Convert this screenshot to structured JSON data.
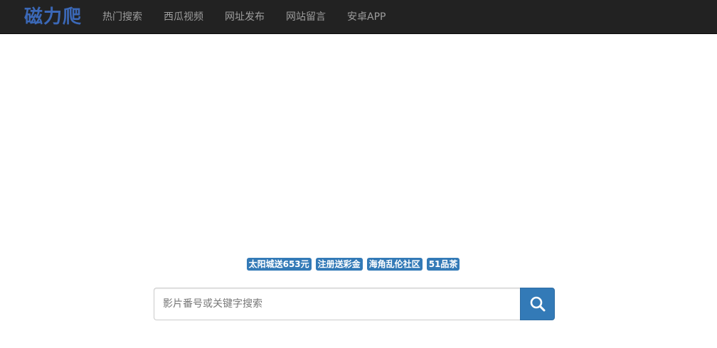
{
  "brand": "磁力爬",
  "nav": {
    "items": [
      {
        "label": "热门搜索"
      },
      {
        "label": "西瓜视频"
      },
      {
        "label": "网址发布"
      },
      {
        "label": "网站留言"
      },
      {
        "label": "安卓APP"
      }
    ]
  },
  "tags": [
    {
      "label": "太阳城送653元"
    },
    {
      "label": "注册送彩金"
    },
    {
      "label": "海角乱伦社区"
    },
    {
      "label": "51品茶"
    }
  ],
  "search": {
    "value": "",
    "placeholder": "影片番号或关键字搜索",
    "button_icon": "search-icon"
  },
  "colors": {
    "navbar_bg": "#222222",
    "brand": "#3b68b7",
    "nav_text": "#9d9d9d",
    "accent": "#337ab7"
  }
}
